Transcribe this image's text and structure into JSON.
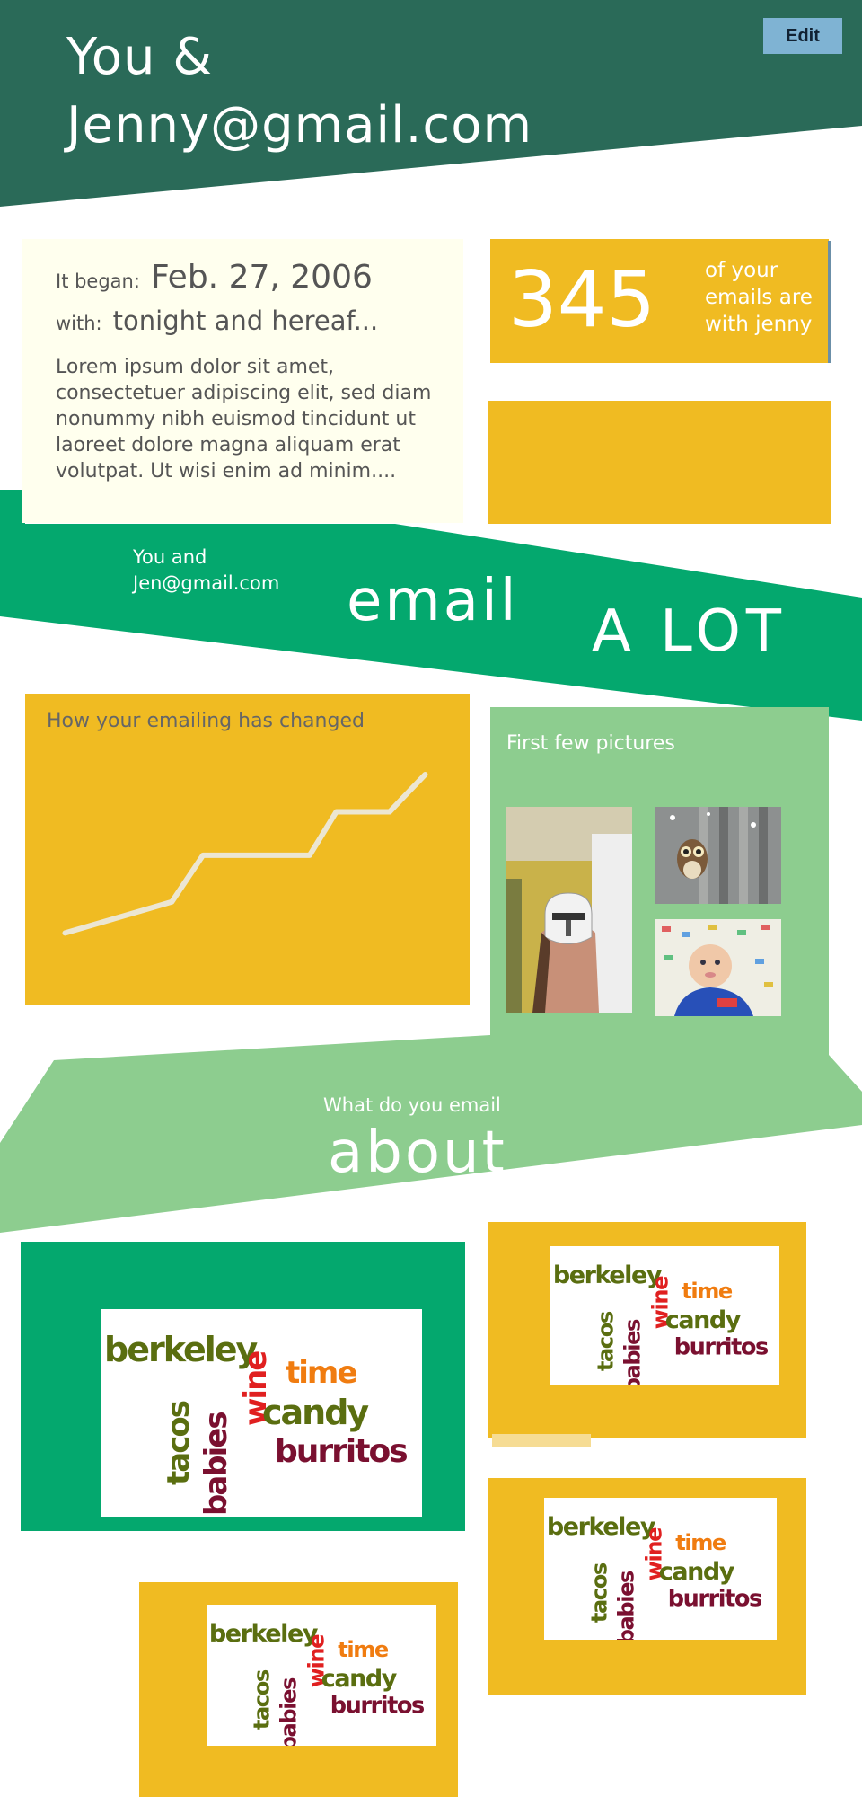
{
  "header": {
    "title_line1": "You &",
    "title_line2": "Jenny@gmail.com",
    "edit_label": "Edit"
  },
  "began": {
    "began_label": "It began:",
    "date": "Feb. 27, 2006",
    "with_label": "with:",
    "subject": "tonight and hereaf...",
    "body": "Lorem ipsum dolor sit amet, consectetuer adipiscing elit, sed diam nonummy nibh euismod tincidunt ut laoreet dolore magna aliquam erat volutpat. Ut wisi enim ad minim...."
  },
  "stat": {
    "count": "345",
    "caption": "of your emails are with jenny"
  },
  "band2": {
    "prefix_line1": "You and",
    "prefix_line2": "Jen@gmail.com",
    "word_email": "email",
    "word_alot": "A LOT"
  },
  "change": {
    "title": "How your emailing has changed",
    "line_points": [
      [
        0.09,
        0.77
      ],
      [
        0.33,
        0.67
      ],
      [
        0.4,
        0.52
      ],
      [
        0.64,
        0.52
      ],
      [
        0.7,
        0.38
      ],
      [
        0.82,
        0.38
      ],
      [
        0.9,
        0.26
      ]
    ]
  },
  "pictures": {
    "title": "First few pictures",
    "photos": [
      "clone-trooper-helmet-photo",
      "owl-photo",
      "baby-photo"
    ]
  },
  "band3": {
    "line1": "What do you email",
    "line2": "about"
  },
  "word_cloud": {
    "words": [
      "berkeley",
      "tacos",
      "babies",
      "wine",
      "time",
      "candy",
      "burritos"
    ]
  },
  "colors": {
    "dark_green": "#2a6a58",
    "green": "#04a86e",
    "light_green": "#8dcd8f",
    "yellow": "#f0bb22",
    "cream": "#ffffee",
    "edit_blue": "#7fb3d3",
    "word_olive": "#5a6e10",
    "word_orange": "#f07c10",
    "word_red": "#e02020",
    "word_maroon": "#7a1030"
  }
}
